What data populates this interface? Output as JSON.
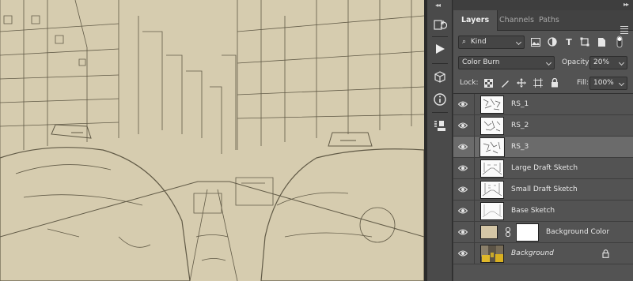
{
  "panel": {
    "tabs": [
      {
        "label": "Layers",
        "active": true
      },
      {
        "label": "Channels",
        "active": false
      },
      {
        "label": "Paths",
        "active": false
      }
    ],
    "filter": {
      "label": "Kind"
    },
    "filter_icons": [
      "image-filter-icon",
      "adjustment-filter-icon",
      "type-filter-icon",
      "shape-filter-icon",
      "smart-object-filter-icon",
      "filter-toggle-icon"
    ],
    "blend_mode": "Color Burn",
    "opacity": {
      "label": "Opacity:",
      "value": "20%"
    },
    "lock": {
      "label": "Lock:",
      "icons": [
        "lock-transparent-pixels-icon",
        "lock-image-pixels-icon",
        "lock-position-icon",
        "lock-artboard-icon",
        "lock-all-icon"
      ]
    },
    "fill": {
      "label": "Fill:",
      "value": "100%"
    }
  },
  "layers": [
    {
      "name": "RS_1",
      "visible": true,
      "selected": false
    },
    {
      "name": "RS_2",
      "visible": true,
      "selected": false
    },
    {
      "name": "RS_3",
      "visible": true,
      "selected": true
    },
    {
      "name": "Large Draft Sketch",
      "visible": true,
      "selected": false
    },
    {
      "name": "Small Draft Sketch",
      "visible": true,
      "selected": false
    },
    {
      "name": "Base Sketch",
      "visible": true,
      "selected": false
    },
    {
      "name": "Background Color",
      "visible": true,
      "selected": false,
      "fill_color": "#d4c6a6",
      "mask_color": "#ffffff"
    },
    {
      "name": "Background",
      "visible": true,
      "selected": false,
      "locked": true
    }
  ],
  "toolstrip": {
    "icons": [
      "history-icon",
      "play-actions-icon",
      "3d-cube-icon",
      "info-icon",
      "clone-source-icon"
    ]
  },
  "colors": {
    "canvas_paper": "#d6ccaf",
    "sketch_ink": "#3a3424",
    "panel_bg": "#535353",
    "selected_row": "#6b6b6b"
  }
}
